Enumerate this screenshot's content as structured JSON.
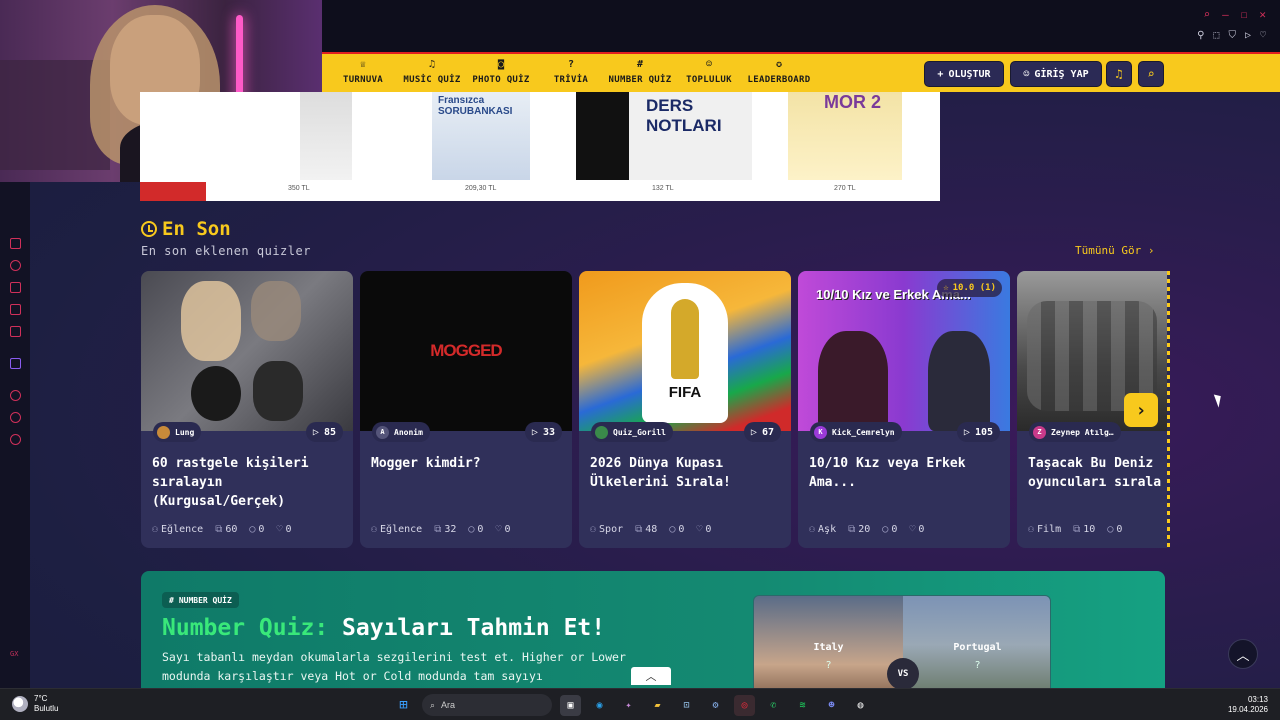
{
  "nav": {
    "items": [
      {
        "label": "TURNUVA",
        "icon": "trophy-icon",
        "glyph": "♕"
      },
      {
        "label": "MUSİC QUİZ",
        "icon": "music-icon",
        "glyph": "♫"
      },
      {
        "label": "PHOTO QUİZ",
        "icon": "camera-icon",
        "glyph": "◙"
      },
      {
        "label": "TRİVİA",
        "icon": "question-icon",
        "glyph": "?"
      },
      {
        "label": "NUMBER QUİZ",
        "icon": "hash-icon",
        "glyph": "#"
      },
      {
        "label": "TOPLULUK",
        "icon": "users-icon",
        "glyph": "☺"
      },
      {
        "label": "LEADERBOARD",
        "icon": "medal-icon",
        "glyph": "✪"
      }
    ],
    "create_label": "OLUŞTUR",
    "login_label": "GİRİŞ YAP"
  },
  "ad": {
    "prices": [
      "350 TL",
      "209,30 TL",
      "132 TL",
      "270 TL"
    ],
    "books": [
      "Fransızca SORUBANKASI",
      "DERS NOTLARI",
      "MOR 2"
    ]
  },
  "section": {
    "title": "En Son",
    "subtitle": "En son eklenen quizler",
    "see_all": "Tümünü Gör ›"
  },
  "cards": [
    {
      "author": "Lung",
      "plays": "85",
      "title": "60 rastgele kişileri sıralayın (Kurgusal/Gerçek)",
      "category": "Eğlence",
      "questions": "60",
      "comments": "0",
      "likes": "0",
      "thumb_text": ""
    },
    {
      "author": "Anonim",
      "plays": "33",
      "title": "Mogger kimdir?",
      "category": "Eğlence",
      "questions": "32",
      "comments": "0",
      "likes": "0",
      "thumb_text": "MOGGED"
    },
    {
      "author": "Quiz_Gorill",
      "plays": "67",
      "title": "2026 Dünya Kupası Ülkelerini Sırala!",
      "category": "Spor",
      "questions": "48",
      "comments": "0",
      "likes": "0",
      "thumb_text": "FIFA"
    },
    {
      "author": "Kick_Cemrelyn",
      "plays": "105",
      "title": "10/10 Kız veya Erkek Ama...",
      "category": "Aşk",
      "questions": "20",
      "comments": "0",
      "likes": "0",
      "thumb_text": "10/10 Kız ve Erkek Ama...",
      "rating": "10.0 (1)"
    },
    {
      "author": "Zeynep Atılg…",
      "plays": "",
      "title": "Taşacak Bu Deniz oyuncuları sırala",
      "category": "Film",
      "questions": "10",
      "comments": "0",
      "likes": "",
      "thumb_text": ""
    }
  ],
  "number_quiz": {
    "tag": "NUMBER QUİZ",
    "title_green": "Number Quiz:",
    "title_white": "Sayıları Tahmin Et!",
    "description": "Sayı tabanlı meydan okumalarla sezgilerini test et. Higher or Lower modunda karşılaştır veya Hot or Cold modunda tam sayıyı",
    "left_country": "Italy",
    "right_country": "Portugal",
    "unknown": "?",
    "vs": "VS"
  },
  "taskbar": {
    "temperature": "7°C",
    "weather": "Bulutlu",
    "search_placeholder": "Ara",
    "time": "03:13",
    "date": "19.04.2026"
  },
  "rail_label": "GX",
  "colors": {
    "accent": "#f8c91d",
    "card": "#30305a",
    "nq": "#148a72"
  }
}
